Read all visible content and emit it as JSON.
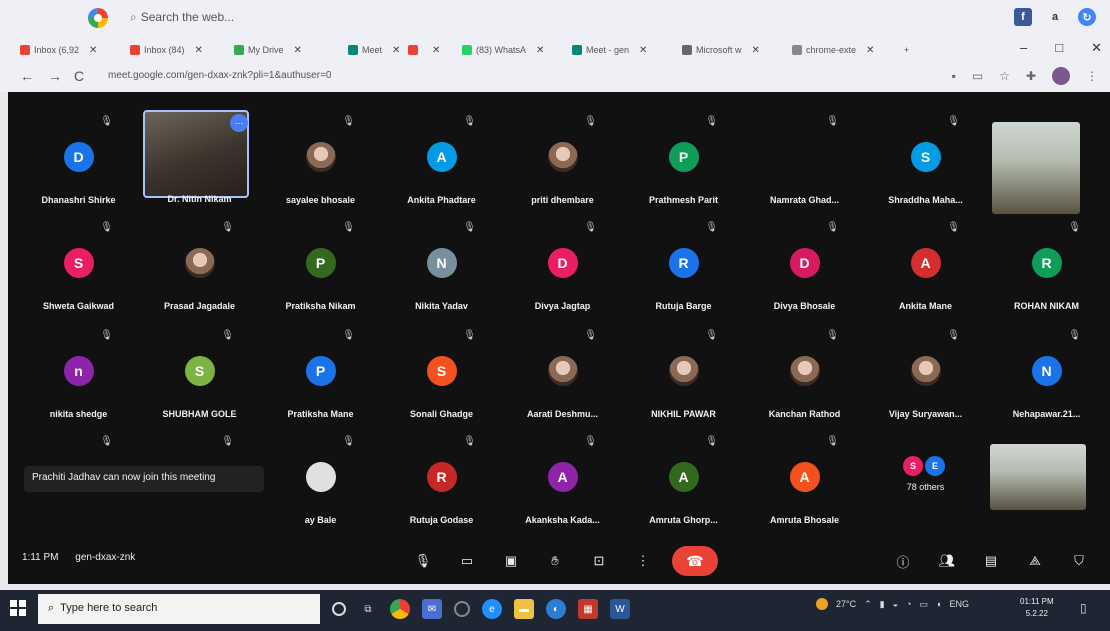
{
  "browser": {
    "search_placeholder": "Search the web...",
    "tabs": [
      {
        "label": "Inbox (6,92",
        "color": "#ea4335"
      },
      {
        "label": "Inbox (84)",
        "color": "#ea4335"
      },
      {
        "label": "My Drive",
        "color": "#34a853"
      },
      {
        "label": "Meet",
        "color": "#00897b"
      },
      {
        "label": "",
        "color": "#ea4335"
      },
      {
        "label": "(83) WhatsA",
        "color": "#25d366"
      },
      {
        "label": "Meet - gen",
        "color": "#00897b"
      },
      {
        "label": "Microsoft w",
        "color": "#666666"
      },
      {
        "label": "chrome-exte",
        "color": "#888888"
      }
    ],
    "new_tab": "+",
    "url": "meet.google.com/gen-dxax-znk?pli=1&authuser=0",
    "min": "–",
    "max": "□",
    "close": "✕",
    "back": "←",
    "forward": "→",
    "reload": "C"
  },
  "meet": {
    "tiles": [
      {
        "name": "Dhanashri Shirke",
        "initial": "D",
        "color": "#1a73e8",
        "type": "avatar"
      },
      {
        "name": "Dr. Nitin Nikam",
        "initial": "",
        "color": "",
        "type": "video",
        "selected": true
      },
      {
        "name": "sayalee bhosale",
        "initial": "",
        "color": "",
        "type": "photo"
      },
      {
        "name": "Ankita Phadtare",
        "initial": "A",
        "color": "#039be5",
        "type": "avatar"
      },
      {
        "name": "priti dhembare",
        "initial": "",
        "color": "",
        "type": "photo"
      },
      {
        "name": "Prathmesh Parit",
        "initial": "P",
        "color": "#0f9d58",
        "type": "avatar"
      },
      {
        "name": "Namrata Ghad...",
        "initial": "",
        "color": "",
        "type": "blank"
      },
      {
        "name": "Shraddha Maha...",
        "initial": "S",
        "color": "#039be5",
        "type": "avatar"
      },
      {
        "name": "Shweta Gaikwad",
        "initial": "S",
        "color": "#e91e63",
        "type": "avatar"
      },
      {
        "name": "Prasad Jagadale",
        "initial": "",
        "color": "",
        "type": "photo"
      },
      {
        "name": "Pratiksha Nikam",
        "initial": "P",
        "color": "#33691e",
        "type": "avatar"
      },
      {
        "name": "Nikita Yadav",
        "initial": "N",
        "color": "#78909c",
        "type": "avatar"
      },
      {
        "name": "Divya Jagtap",
        "initial": "D",
        "color": "#e91e63",
        "type": "avatar"
      },
      {
        "name": "Rutuja Barge",
        "initial": "R",
        "color": "#1a73e8",
        "type": "avatar"
      },
      {
        "name": "Divya Bhosale",
        "initial": "D",
        "color": "#d81b60",
        "type": "avatar"
      },
      {
        "name": "Ankita Mane",
        "initial": "A",
        "color": "#d32f2f",
        "type": "avatar"
      },
      {
        "name": "ROHAN NIKAM",
        "initial": "R",
        "color": "#0f9d58",
        "type": "avatar"
      },
      {
        "name": "nikita shedge",
        "initial": "n",
        "color": "#8e24aa",
        "type": "avatar"
      },
      {
        "name": "SHUBHAM GOLE",
        "initial": "S",
        "color": "#7cb342",
        "type": "avatar"
      },
      {
        "name": "Pratiksha Mane",
        "initial": "P",
        "color": "#1a73e8",
        "type": "avatar"
      },
      {
        "name": "Sonali Ghadge",
        "initial": "S",
        "color": "#f4511e",
        "type": "avatar"
      },
      {
        "name": "Aarati Deshmu...",
        "initial": "",
        "color": "",
        "type": "photo"
      },
      {
        "name": "NIKHIL PAWAR",
        "initial": "",
        "color": "",
        "type": "photo"
      },
      {
        "name": "Kanchan Rathod",
        "initial": "",
        "color": "",
        "type": "photo"
      },
      {
        "name": "Vijay Suryawan...",
        "initial": "",
        "color": "",
        "type": "photo"
      },
      {
        "name": "Nehapawar.21...",
        "initial": "N",
        "color": "#1a73e8",
        "type": "avatar"
      },
      {
        "name": "",
        "initial": "",
        "color": "",
        "type": "blank"
      },
      {
        "name": "",
        "initial": "",
        "color": "",
        "type": "blank"
      },
      {
        "name": "ay Bale",
        "initial": "",
        "color": "#e0e0e0",
        "type": "avatar"
      },
      {
        "name": "Rutuja Godase",
        "initial": "R",
        "color": "#c62828",
        "type": "avatar"
      },
      {
        "name": "Akanksha Kada...",
        "initial": "A",
        "color": "#8e24aa",
        "type": "avatar"
      },
      {
        "name": "Amruta Ghorp...",
        "initial": "A",
        "color": "#33691e",
        "type": "avatar"
      },
      {
        "name": "Amruta Bhosale",
        "initial": "A",
        "color": "#f4511e",
        "type": "avatar"
      },
      {
        "name": "78 others",
        "initial": "",
        "color": "",
        "type": "others"
      }
    ],
    "others_dots": [
      {
        "initial": "S",
        "color": "#e91e63"
      },
      {
        "initial": "E",
        "color": "#1a73e8"
      }
    ],
    "toast": "Prachiti Jadhav can now join this meeting",
    "time": "1:11 PM",
    "meeting_code": "gen-dxax-znk"
  },
  "taskbar": {
    "search_placeholder": "Type here to search",
    "weather": "27°C",
    "lang": "ENG",
    "time": "01:11 PM",
    "date": "5.2.22"
  }
}
